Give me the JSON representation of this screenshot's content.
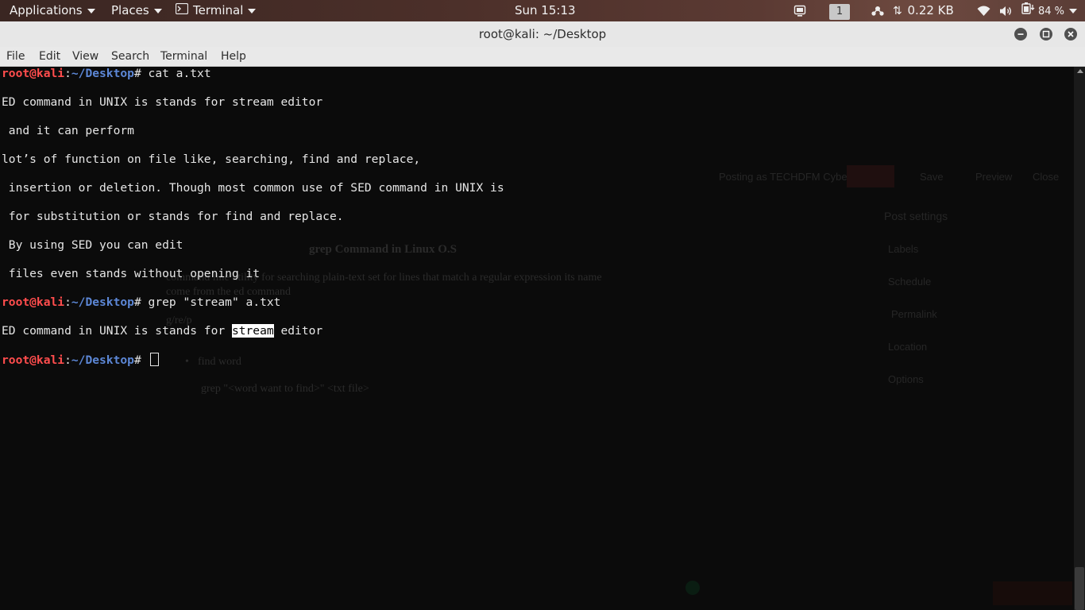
{
  "topbar": {
    "applications": "Applications",
    "places": "Places",
    "terminal_menu": "Terminal",
    "clock": "Sun 15:13",
    "workspace": "1",
    "network_rate": "0.22 KB",
    "battery": "84 %",
    "icons": [
      "terminal-icon",
      "display-icon",
      "network-monitor-icon",
      "wifi-icon",
      "volume-icon",
      "battery-icon"
    ]
  },
  "window": {
    "title": "root@kali: ~/Desktop",
    "controls": [
      "minimize-icon",
      "maximize-icon",
      "close-icon"
    ]
  },
  "menu": [
    "File",
    "Edit",
    "View",
    "Search",
    "Terminal",
    "Help"
  ],
  "prompt": {
    "user": "root@kali",
    "sep": ":",
    "path": "~/Desktop",
    "hash": "# "
  },
  "terminal": {
    "command1": "cat a.txt",
    "output": [
      "ED command in UNIX is stands for stream editor",
      " and it can perform",
      "lot’s of function on file like, searching, find and replace,",
      " insertion or deletion. Though most common use of SED command in UNIX is",
      " for substitution or stands for find and replace.",
      " By using SED you can edit",
      " files even stands without opening it"
    ],
    "command2": "grep \"stream\" a.txt",
    "grep_result": {
      "before": "ED command in UNIX is stands for ",
      "match": "stream",
      "after": " editor"
    }
  },
  "background": {
    "heading": "grep Command in Linux O.S",
    "para_line1": "command line utility for searching plain-text set for lines that match a regular expression its name",
    "para_line2": "come from the ed command",
    "word": "g/re/p",
    "bullet": "find word",
    "code": "grep \"<word want to find>\" <txt file>",
    "posting_as": "Posting as TECHDFM Cyber",
    "save": "Save",
    "preview": "Preview",
    "close": "Close",
    "post_settings": "Post settings",
    "labels": "Labels",
    "schedule": "Schedule",
    "permalink": "Permalink",
    "location": "Location",
    "options": "Options"
  }
}
